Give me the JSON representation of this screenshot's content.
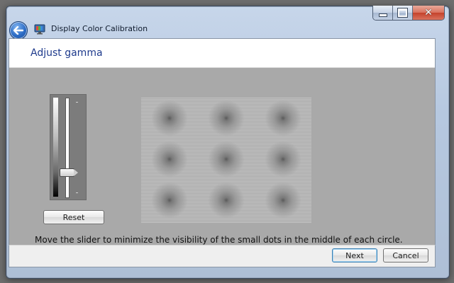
{
  "window": {
    "title": "Display Color Calibration",
    "controls": {
      "minimize_icon": "minimize-icon",
      "maximize_icon": "maximize-icon",
      "close_icon": "close-icon",
      "close_glyph": "✕"
    }
  },
  "page": {
    "heading": "Adjust gamma",
    "instruction": "Move the slider to minimize the visibility of the small dots in the middle of each circle."
  },
  "slider": {
    "icon": "gamma-slider",
    "position_fraction": 0.25
  },
  "buttons": {
    "reset": "Reset",
    "next": "Next",
    "cancel": "Cancel"
  },
  "colors": {
    "heading": "#1e3a8c",
    "content_bg": "#a9a9a9",
    "accent": "#2c6cc5"
  }
}
